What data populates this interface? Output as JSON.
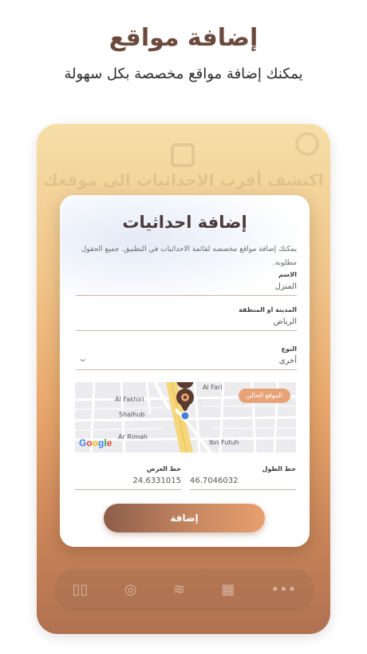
{
  "hero": {
    "title": "إضافة مواقع",
    "subtitle": "يمكنك إضافة مواقع مخصصة بكل سهولة"
  },
  "background_app": {
    "title": "اكتشف أقرب الاحداثيات الى موقعك"
  },
  "dialog": {
    "title": "إضافة احداثيات",
    "description": "يمكنك إضافة مواقع مخصصه لقائمة الاحداثيات في التطبيق. جميع الحقول مطلوبة.",
    "fields": {
      "name": {
        "label": "الاسم",
        "value": "المنزل"
      },
      "city": {
        "label": "المدينة او المنطقة",
        "value": "الرياض"
      },
      "type": {
        "label": "النوع",
        "value": "أخرى"
      },
      "longitude": {
        "label": "خط الطول",
        "value": "46.7046032"
      },
      "latitude": {
        "label": "خط العرض",
        "value": "24.6331015"
      }
    },
    "map": {
      "current_location_button": "الموقع الحالي",
      "street_labels": [
        "Al Fakhiri",
        "Shalhub",
        "Ar Rimah",
        "Ibn Futuh",
        "Al Fari"
      ],
      "logo": "Google"
    },
    "submit_label": "إضافة"
  },
  "colors": {
    "accent": "#c58761",
    "button_dark": "#8d5d4a",
    "map_pin": "#5a3b2e",
    "location_dot": "#4a7fd6"
  }
}
